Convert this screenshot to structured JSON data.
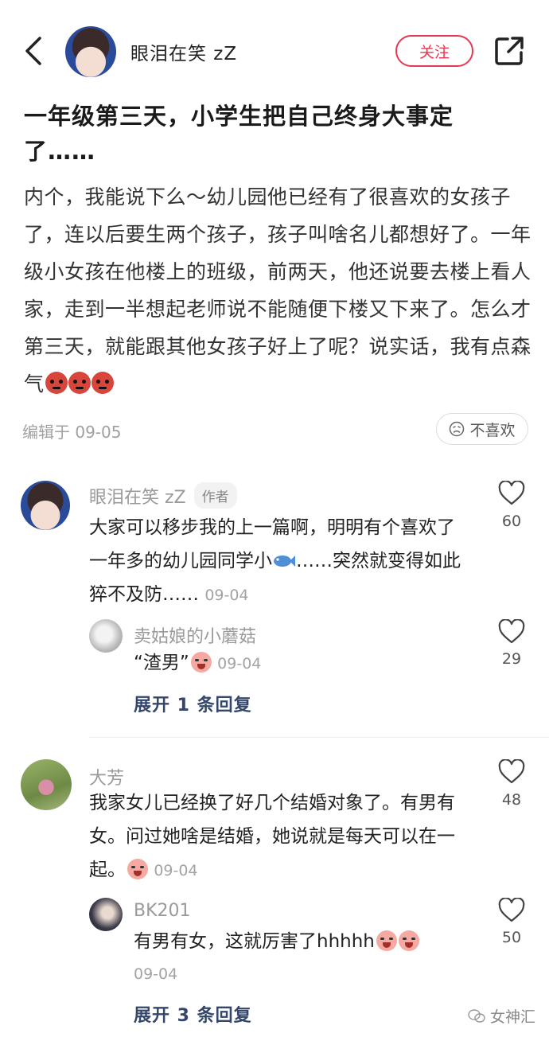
{
  "header": {
    "author_name": "眼泪在笑 zZ",
    "follow_label": "关注"
  },
  "post": {
    "title": "一年级第三天，小学生把自己终身大事定了……",
    "body": "内个，我能说下么～幼儿园他已经有了很喜欢的女孩子了，连以后要生两个孩子，孩子叫啥名儿都想好了。一年级小女孩在他楼上的班级，前两天，他还说要去楼上看人家，走到一半想起老师说不能随便下楼又下来了。怎么才第三天，就能跟其他女孩子好上了呢？说实话，我有点森气",
    "edit_time": "编辑于 09-05",
    "dislike_label": "不喜欢"
  },
  "comments": [
    {
      "name": "眼泪在笑 zZ",
      "tag": "作者",
      "text_a": "大家可以移步我的上一篇啊，明明有个喜欢了一年多的幼儿园同学小",
      "text_b": "……突然就变得如此猝不及防……",
      "time": "09-04",
      "likes": "60",
      "reply": {
        "name": "卖姑娘的小蘑菇",
        "text": "“渣男”",
        "time": "09-04",
        "likes": "29"
      },
      "expand_label": "展开 1 条回复"
    },
    {
      "name": "大芳",
      "text": "我家女儿已经换了好几个结婚对象了。有男有女。问过她啥是结婚，她说就是每天可以在一起。",
      "time": "09-04",
      "likes": "48",
      "reply": {
        "name": "BK201",
        "text": "有男有女，这就厉害了hhhhh",
        "time": "09-04",
        "likes": "50"
      },
      "expand_label": "展开 3 条回复"
    }
  ],
  "watermark": "女神汇",
  "icons": [
    "back-icon",
    "share-icon",
    "dislike-face-icon",
    "heart-icon",
    "devil-emoji",
    "crying-emoji",
    "fish-emoji",
    "wechat-icon"
  ],
  "colors": {
    "accent": "#e53950",
    "link": "#34476b"
  }
}
